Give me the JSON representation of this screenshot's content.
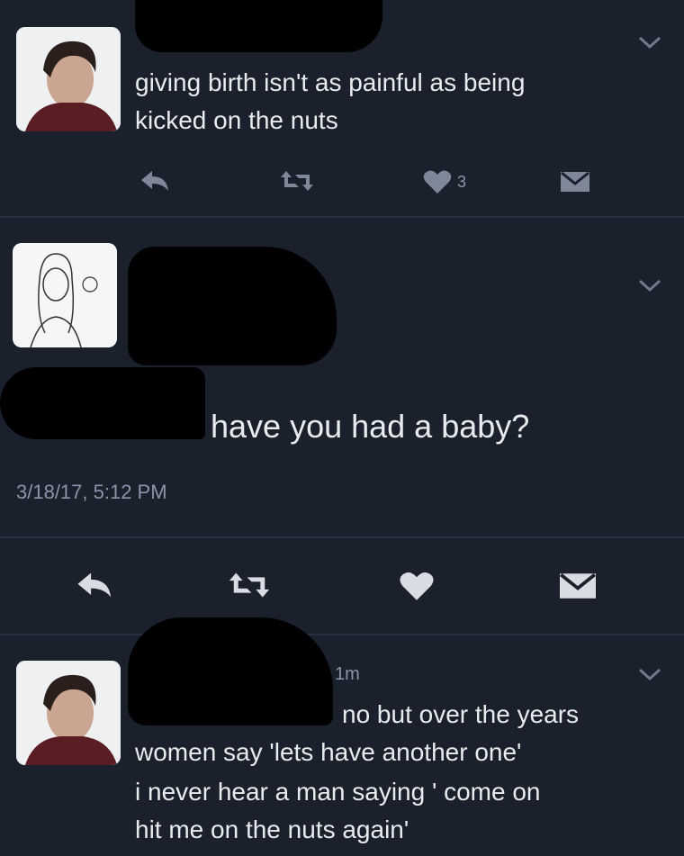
{
  "tweets": [
    {
      "text_lines": [
        "giving birth isn't as painful as being",
        "kicked on the nuts"
      ],
      "like_count": "3"
    },
    {
      "text": "have you had a baby?",
      "timestamp": "3/18/17, 5:12 PM"
    },
    {
      "time_ago": "1m",
      "text_lines": [
        "no but over the years",
        "women say 'lets have another one'",
        "i never hear a man saying ' come on",
        "hit me on the nuts again'"
      ]
    }
  ],
  "icons": {
    "reply": "reply-icon",
    "retweet": "retweet-icon",
    "like": "heart-icon",
    "dm": "envelope-icon",
    "more": "chevron-down-icon"
  },
  "colors": {
    "background": "#1a212d",
    "text": "#e9ebef",
    "muted": "#8b95a6"
  }
}
